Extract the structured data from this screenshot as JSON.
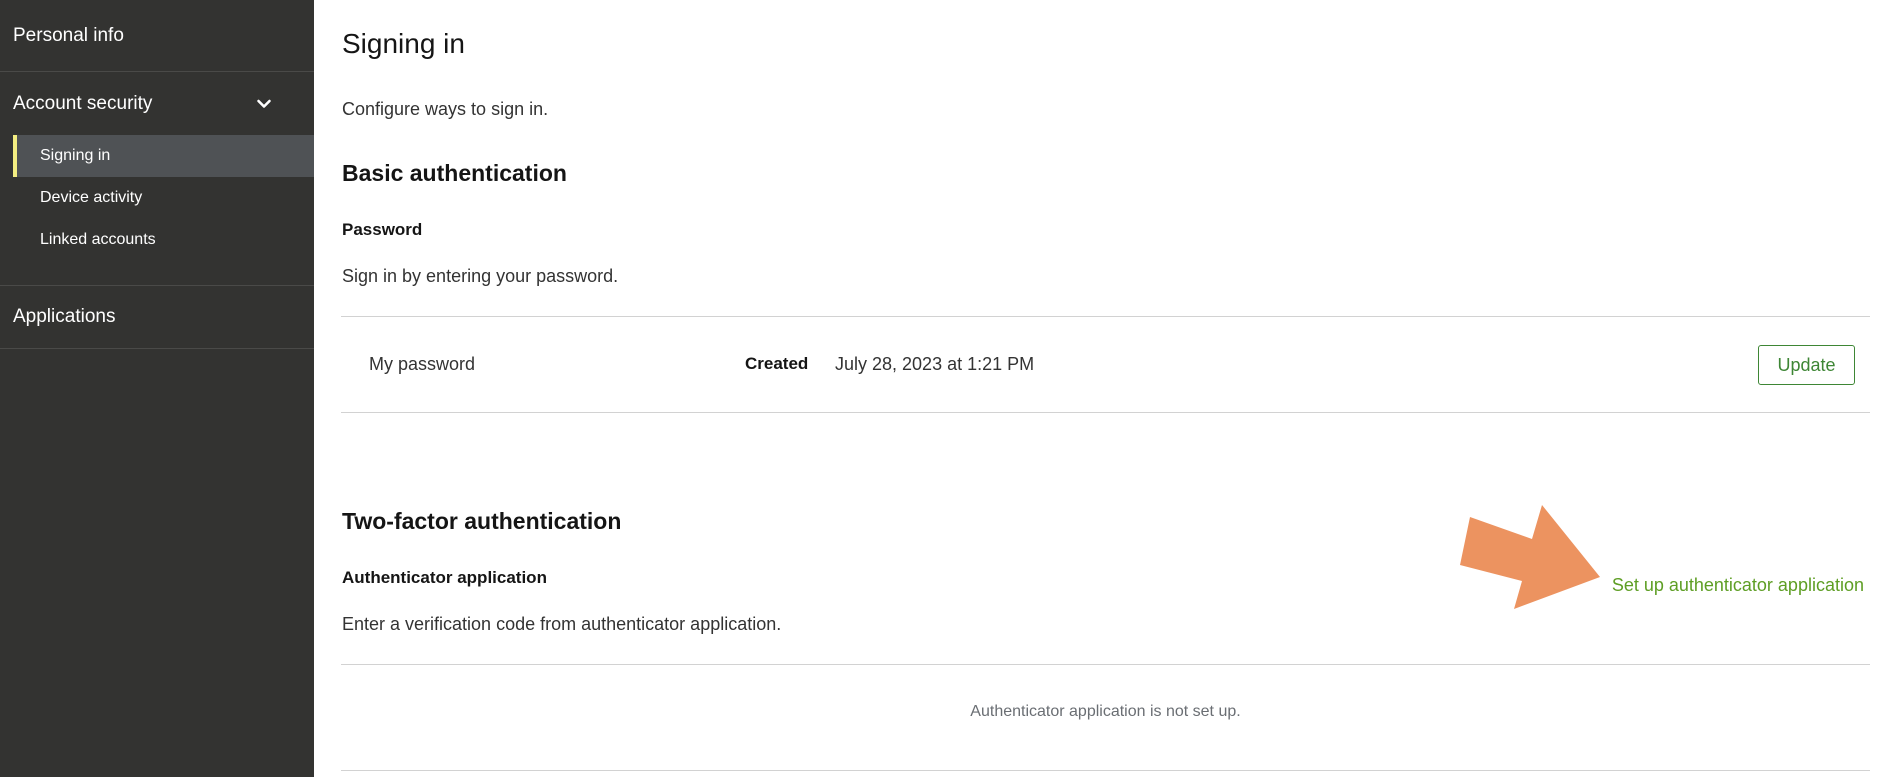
{
  "sidebar": {
    "personal_info": "Personal info",
    "account_security": "Account security",
    "sub_items": [
      {
        "label": "Signing in"
      },
      {
        "label": "Device activity"
      },
      {
        "label": "Linked accounts"
      }
    ],
    "applications": "Applications"
  },
  "main": {
    "title": "Signing in",
    "description": "Configure ways to sign in.",
    "basic": {
      "title": "Basic authentication",
      "password_title": "Password",
      "password_desc": "Sign in by entering your password.",
      "row": {
        "name": "My password",
        "created_label": "Created",
        "created_value": "July 28, 2023 at 1:21 PM",
        "update_label": "Update"
      }
    },
    "two_factor": {
      "title": "Two-factor authentication",
      "auth_title": "Authenticator application",
      "auth_desc": "Enter a verification code from authenticator application.",
      "setup_link": "Set up authenticator application",
      "empty_message": "Authenticator application is not set up."
    }
  },
  "colors": {
    "sidebar_bg": "#333331",
    "active_bg": "#4f5255",
    "active_accent": "#f4ee82",
    "link_green": "#5e9e24",
    "button_green": "#3e8635",
    "arrow_orange": "#ec9360"
  },
  "icons": {
    "expand": "chevron-down-icon",
    "annotation": "arrow-right-icon"
  }
}
